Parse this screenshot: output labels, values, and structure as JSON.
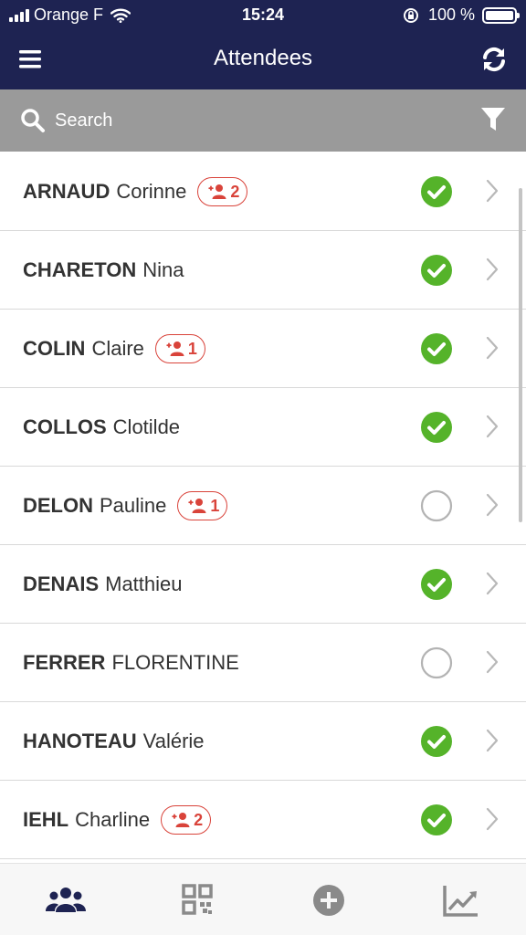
{
  "status": {
    "carrier": "Orange F",
    "time": "15:24",
    "battery": "100 %",
    "battery_level": 1.0
  },
  "navbar": {
    "title": "Attendees",
    "menu_icon": "hamburger-menu-icon",
    "refresh_icon": "refresh-icon"
  },
  "search": {
    "placeholder": "Search",
    "value": "",
    "filter_icon": "filter-icon"
  },
  "colors": {
    "header_bg": "#1e2352",
    "search_bg": "#9a9a9a",
    "checked": "#55b32a",
    "badge": "#d9433a",
    "tab_active": "#1e2352",
    "tab_inactive": "#8a8a8a"
  },
  "attendees": [
    {
      "last": "ARNAUD",
      "first": "Corinne",
      "guests": "2",
      "checked_in": true
    },
    {
      "last": "CHARETON",
      "first": "Nina",
      "guests": "",
      "checked_in": true
    },
    {
      "last": "COLIN",
      "first": "Claire",
      "guests": "1",
      "checked_in": true
    },
    {
      "last": "COLLOS",
      "first": "Clotilde",
      "guests": "",
      "checked_in": true
    },
    {
      "last": "DELON",
      "first": "Pauline",
      "guests": "1",
      "checked_in": false
    },
    {
      "last": "DENAIS",
      "first": "Matthieu",
      "guests": "",
      "checked_in": true
    },
    {
      "last": "FERRER",
      "first": "FLORENTINE",
      "guests": "",
      "checked_in": false
    },
    {
      "last": "HANOTEAU",
      "first": "Valérie",
      "guests": "",
      "checked_in": true
    },
    {
      "last": "IEHL",
      "first": "Charline",
      "guests": "2",
      "checked_in": true
    }
  ],
  "tabs": [
    {
      "icon": "attendees-group-icon",
      "active": true
    },
    {
      "icon": "qr-code-icon",
      "active": false
    },
    {
      "icon": "add-circle-icon",
      "active": false
    },
    {
      "icon": "stats-chart-icon",
      "active": false
    }
  ]
}
